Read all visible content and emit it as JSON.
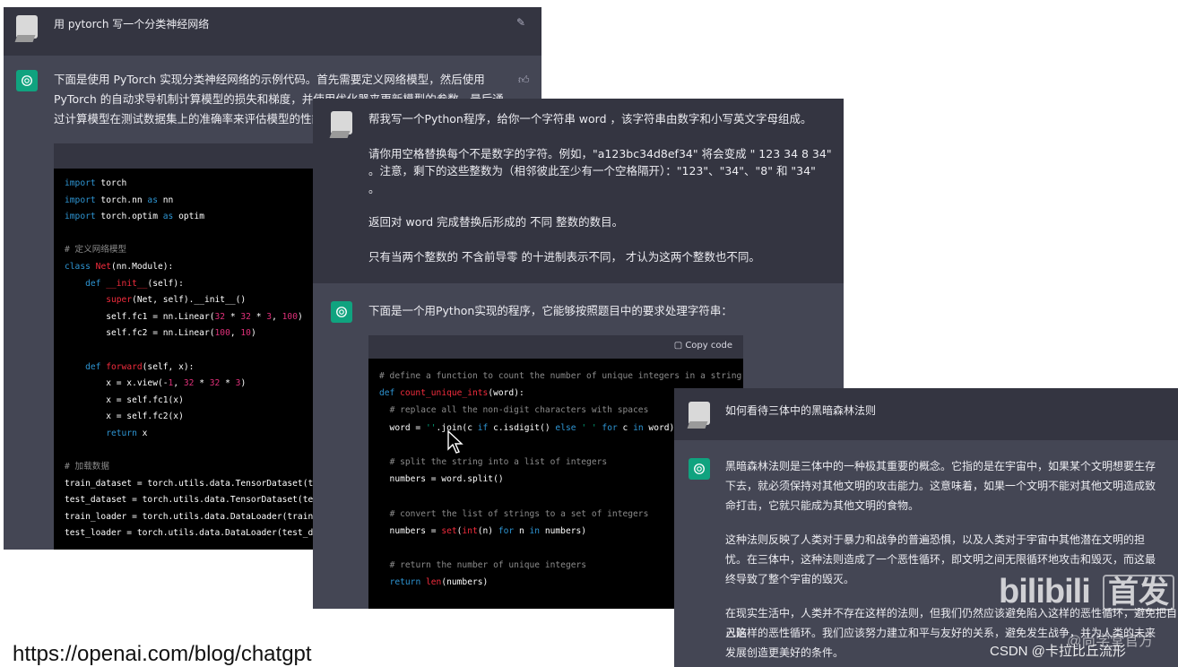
{
  "panel1": {
    "user_prompt": "用 pytorch 写一个分类神经网络",
    "bot_intro_l1": "下面是使用 PyTorch 实现分类神经网络的示例代码。首先需要定义网络模型，然后使用",
    "bot_intro_l2": "PyTorch 的自动求导机制计算模型的损失和梯度，并使用优化器来更新模型的参数。最后通",
    "bot_intro_l3": "过计算模型在测试数据集上的准确率来评估模型的性能。",
    "edit_icon": "edit-icon",
    "thumb_icon": "thumbs-up-icon"
  },
  "panel2": {
    "user_l1": "帮我写一个Python程序，给你一个字符串 word ，该字符串由数字和小写英文字母组成。",
    "user_l2": "请你用空格替换每个不是数字的字符。例如，\"a123bc34d8ef34\" 将会变成 \" 123  34 8  34\"",
    "user_l3": "。注意，剩下的这些整数为（相邻彼此至少有一个空格隔开）：\"123\"、\"34\"、\"8\" 和 \"34\"",
    "user_l4": "。",
    "user_l5": "返回对 word 完成替换后形成的 不同 整数的数目。",
    "user_l6": "只有当两个整数的 不含前导零 的十进制表示不同， 才认为这两个整数也不同。",
    "bot_intro": "下面是一个用Python实现的程序，它能够按照题目中的要求处理字符串：",
    "copy_label": "Copy code"
  },
  "panel3": {
    "user_prompt": "如何看待三体中的黑暗森林法则",
    "p1_l1": "黑暗森林法则是三体中的一种极其重要的概念。它指的是在宇宙中，如果某个文明想要生存",
    "p1_l2": "下去，就必须保持对其他文明的攻击能力。这意味着，如果一个文明不能对其他文明造成致",
    "p1_l3": "命打击，它就只能成为其他文明的食物。",
    "p2_l1": "这种法则反映了人类对于暴力和战争的普遍恐惧，以及人类对于宇宙中其他潜在文明的担",
    "p2_l2": "忧。在三体中，这种法则造成了一个恶性循环，即文明之间无限循环地攻击和毁灭，而这最",
    "p2_l3": "终导致了整个宇宙的毁灭。",
    "p3_l1": "在现实生活中，人类并不存在这样的法则，但我们仍然应该避免陷入这样的恶性循环，避免把自己陷",
    "p3_l2": "入这样的恶性循环。我们应该努力建立和平与友好的关系，避免发生战争，并为人类的未来",
    "p3_l3": "发展创造更美好的条件。"
  },
  "footer": {
    "url": "https://openai.com/blog/chatgpt",
    "watermark_brand": "bilibili",
    "watermark_tag": "首发",
    "watermark_csdn": "CSDN @卡拉比丘流形",
    "watermark_author": "@尚学堂官方"
  }
}
